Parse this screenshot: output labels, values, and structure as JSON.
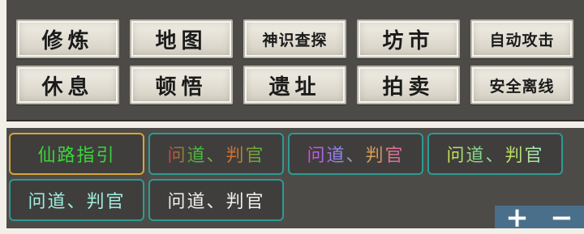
{
  "menu": {
    "items": [
      {
        "label": "修炼",
        "size": "large"
      },
      {
        "label": "地图",
        "size": "large"
      },
      {
        "label": "神识查探",
        "size": "small"
      },
      {
        "label": "坊市",
        "size": "large"
      },
      {
        "label": "自动攻击",
        "size": "small"
      },
      {
        "label": "休息",
        "size": "large"
      },
      {
        "label": "顿悟",
        "size": "large"
      },
      {
        "label": "遗址",
        "size": "large"
      },
      {
        "label": "拍卖",
        "size": "large"
      },
      {
        "label": "安全离线",
        "size": "small"
      }
    ]
  },
  "titles": {
    "items": [
      {
        "label": "仙路指引",
        "style": "green",
        "border": "gold"
      },
      {
        "label": "问道、判官",
        "style": "grad1",
        "border": "teal"
      },
      {
        "label": "问道、判官",
        "style": "grad2",
        "border": "teal"
      },
      {
        "label": "问道、判官",
        "style": "grad3",
        "border": "teal"
      },
      {
        "label": "问道、判官",
        "style": "cyan",
        "border": "teal"
      },
      {
        "label": "问道、判官",
        "style": "white",
        "border": "teal"
      }
    ]
  },
  "zoom": {
    "plus_label": "+",
    "minus_label": "−"
  },
  "colors": {
    "panel_bg": "#4d4b48",
    "teal_border": "#2e9a92",
    "gold_border": "#d8a53a",
    "zoom_bg": "#4a6f8a"
  }
}
